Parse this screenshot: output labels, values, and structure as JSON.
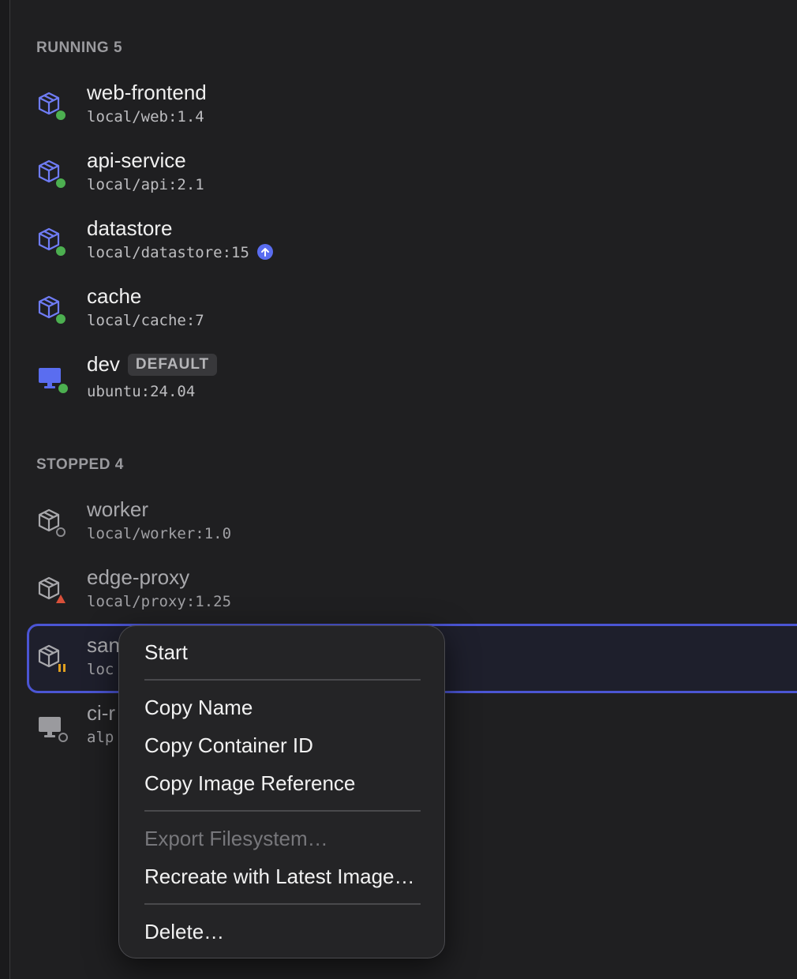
{
  "sections": {
    "running_label": "RUNNING 5",
    "stopped_label": "STOPPED 4"
  },
  "running": [
    {
      "name": "web-frontend",
      "image": "local/web:1.4",
      "icon": "container-icon",
      "status": "running"
    },
    {
      "name": "api-service",
      "image": "local/api:2.1",
      "icon": "container-icon",
      "status": "running"
    },
    {
      "name": "datastore",
      "image": "local/datastore:15",
      "icon": "container-icon",
      "status": "running",
      "update_available": true
    },
    {
      "name": "cache",
      "image": "local/cache:7",
      "icon": "container-icon",
      "status": "running"
    },
    {
      "name": "dev",
      "image": "ubuntu:24.04",
      "icon": "machine-icon",
      "status": "running",
      "badge": "DEFAULT"
    }
  ],
  "stopped": [
    {
      "name": "worker",
      "image": "local/worker:1.0",
      "icon": "container-icon",
      "status": "stopped"
    },
    {
      "name": "edge-proxy",
      "image": "local/proxy:1.25",
      "icon": "container-icon",
      "status": "error"
    },
    {
      "name": "san",
      "image": "loc",
      "icon": "container-icon",
      "status": "paused",
      "selected": true
    },
    {
      "name": "ci-r",
      "image": "alp",
      "icon": "machine-icon",
      "status": "stopped"
    }
  ],
  "context_menu": {
    "start": "Start",
    "copy_name": "Copy Name",
    "copy_container_id": "Copy Container ID",
    "copy_image_reference": "Copy Image Reference",
    "export_filesystem": "Export Filesystem…",
    "recreate": "Recreate with Latest Image…",
    "delete": "Delete…"
  },
  "colors": {
    "background": "#1f1f21",
    "accent": "#5a6df0",
    "running": "#4caf50",
    "error": "#d9503a",
    "paused": "#e0a020",
    "selection_border": "#4b55d4"
  }
}
